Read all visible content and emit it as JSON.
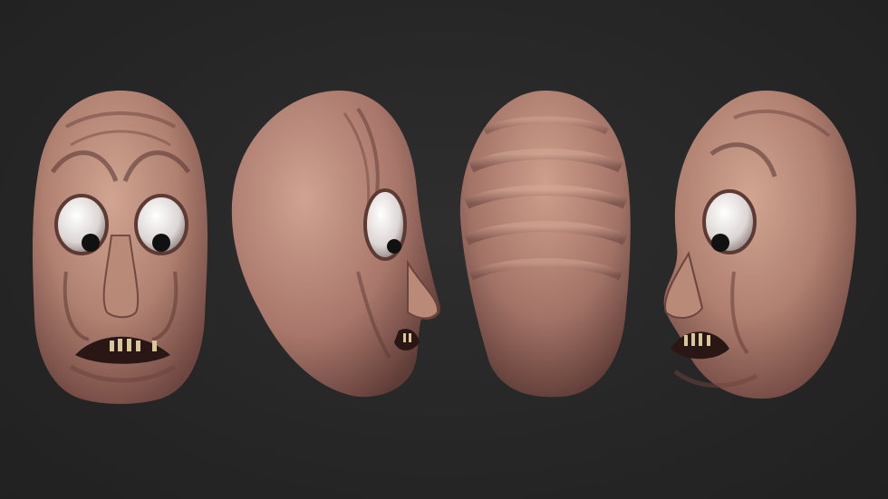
{
  "scene": {
    "background": "#262626",
    "skin_light": "#c99a86",
    "skin_mid": "#a8766a",
    "skin_dark": "#6e4640",
    "sclera": "#e9e4e2",
    "pupil": "#111111",
    "teeth": "#d8c79a"
  },
  "views": [
    {
      "id": "front",
      "icon": "sculpted-head-front-view"
    },
    {
      "id": "side-right",
      "icon": "sculpted-head-right-profile-view"
    },
    {
      "id": "back",
      "icon": "sculpted-head-back-view"
    },
    {
      "id": "three-quarter-left",
      "icon": "sculpted-head-three-quarter-left-view"
    }
  ]
}
